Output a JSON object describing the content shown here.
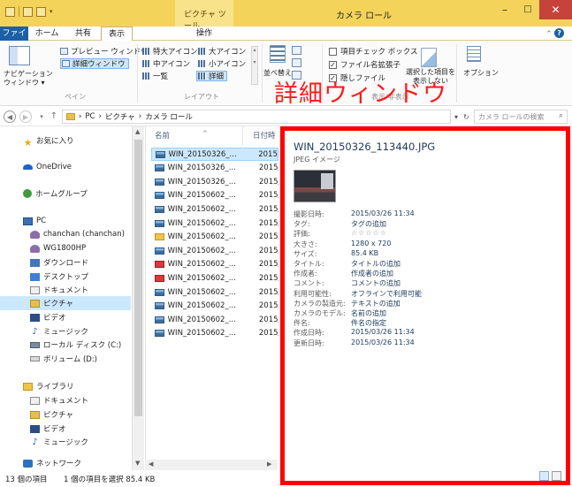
{
  "titlebar": {
    "context_tab": "ピクチャ ツール",
    "title": "カメラ ロール",
    "min": "–",
    "max": "□",
    "close": "✕"
  },
  "menu": {
    "file": "ファイル",
    "home": "ホーム",
    "share": "共有",
    "view": "表示",
    "manage": "操作",
    "help": "?"
  },
  "ribbon": {
    "nav_pane": [
      "ナビゲーション",
      "ウィンドウ ▾"
    ],
    "preview_pane": "プレビュー ウィンドウ",
    "details_pane": "詳細ウィンドウ",
    "group_pane": "ペイン",
    "layout": {
      "extra_large": "特大アイコン",
      "large": "大アイコン",
      "medium": "中アイコン",
      "small": "小アイコン",
      "list": "一覧",
      "details": "詳細"
    },
    "group_layout": "レイアウト",
    "sort_by": "並べ替え",
    "item_checkboxes": "項目チェック ボックス",
    "file_extensions": "ファイル名拡張子",
    "hidden_items": "隠しファイル",
    "hide_selected": [
      "選択した項目を",
      "表示しない"
    ],
    "group_showhide": "表示/非表示",
    "options": "オプション"
  },
  "annotation": "詳細ウィンドウ",
  "address": {
    "path": [
      "PC",
      "ピクチャ",
      "カメラ ロール"
    ],
    "search_placeholder": "カメラ ロールの検索"
  },
  "nav": {
    "favorites": "お気に入り",
    "onedrive": "OneDrive",
    "homegroup": "ホームグループ",
    "pc": "PC",
    "user": "chanchan (chanchan)",
    "device": "WG1800HP",
    "downloads": "ダウンロード",
    "desktop": "デスクトップ",
    "documents": "ドキュメント",
    "pictures": "ピクチャ",
    "videos": "ビデオ",
    "music": "ミュージック",
    "local_disk": "ローカル ディスク (C:)",
    "volume": "ボリューム (D:)",
    "libraries": "ライブラリ",
    "lib_documents": "ドキュメント",
    "lib_pictures": "ピクチャ",
    "lib_videos": "ビデオ",
    "lib_music": "ミュージック",
    "network": "ネットワーク"
  },
  "filelist": {
    "col_name": "名前",
    "col_date": "日付時",
    "rows": [
      {
        "name": "WIN_20150326_...",
        "date": "2015/0",
        "kind": "jpg"
      },
      {
        "name": "WIN_20150326_...",
        "date": "2015/0",
        "kind": "jpg"
      },
      {
        "name": "WIN_20150326_...",
        "date": "2015/0",
        "kind": "jpg"
      },
      {
        "name": "WIN_20150602_...",
        "date": "2015/0",
        "kind": "jpg"
      },
      {
        "name": "WIN_20150602_...",
        "date": "2015/0",
        "kind": "jpg"
      },
      {
        "name": "WIN_20150602_...",
        "date": "2015/0",
        "kind": "jpg"
      },
      {
        "name": "WIN_20150602_...",
        "date": "2015/0",
        "kind": "folder"
      },
      {
        "name": "WIN_20150602_...",
        "date": "2015/0",
        "kind": "jpg"
      },
      {
        "name": "WIN_20150602_...",
        "date": "2015/0",
        "kind": "mp4"
      },
      {
        "name": "WIN_20150602_...",
        "date": "2015/0",
        "kind": "mp4"
      },
      {
        "name": "WIN_20150602_...",
        "date": "2015/0",
        "kind": "jpg"
      },
      {
        "name": "WIN_20150602_...",
        "date": "2015/0",
        "kind": "jpg"
      },
      {
        "name": "WIN_20150602_...",
        "date": "2015/0",
        "kind": "jpg"
      },
      {
        "name": "WIN_20150602_...",
        "date": "2015/0",
        "kind": "jpg"
      }
    ]
  },
  "details": {
    "filename": "WIN_20150326_113440.JPG",
    "type": "JPEG イメージ",
    "props": [
      {
        "k": "撮影日時:",
        "v": "2015/03/26 11:34"
      },
      {
        "k": "タグ:",
        "v": "タグの追加"
      },
      {
        "k": "評価:",
        "v": "☆☆☆☆☆"
      },
      {
        "k": "大きさ:",
        "v": "1280 x 720"
      },
      {
        "k": "サイズ:",
        "v": "85.4 KB"
      },
      {
        "k": "タイトル:",
        "v": "タイトルの追加"
      },
      {
        "k": "作成者:",
        "v": "作成者の追加"
      },
      {
        "k": "コメント:",
        "v": "コメントの追加"
      },
      {
        "k": "利用可能性:",
        "v": "オフラインで利用可能"
      },
      {
        "k": "カメラの製造元:",
        "v": "テキストの追加"
      },
      {
        "k": "カメラのモデル:",
        "v": "名前の追加"
      },
      {
        "k": "件名:",
        "v": "件名の指定"
      },
      {
        "k": "作成日時:",
        "v": "2015/03/26 11:34"
      },
      {
        "k": "更新日時:",
        "v": "2015/03/26 11:34"
      }
    ]
  },
  "status": {
    "count": "13 個の項目",
    "selection": "1 個の項目を選択 85.4 KB"
  },
  "colors": {
    "title_bar": "#f4d35a",
    "accent": "#1c5fa5",
    "highlight_border": "#ff0000"
  }
}
